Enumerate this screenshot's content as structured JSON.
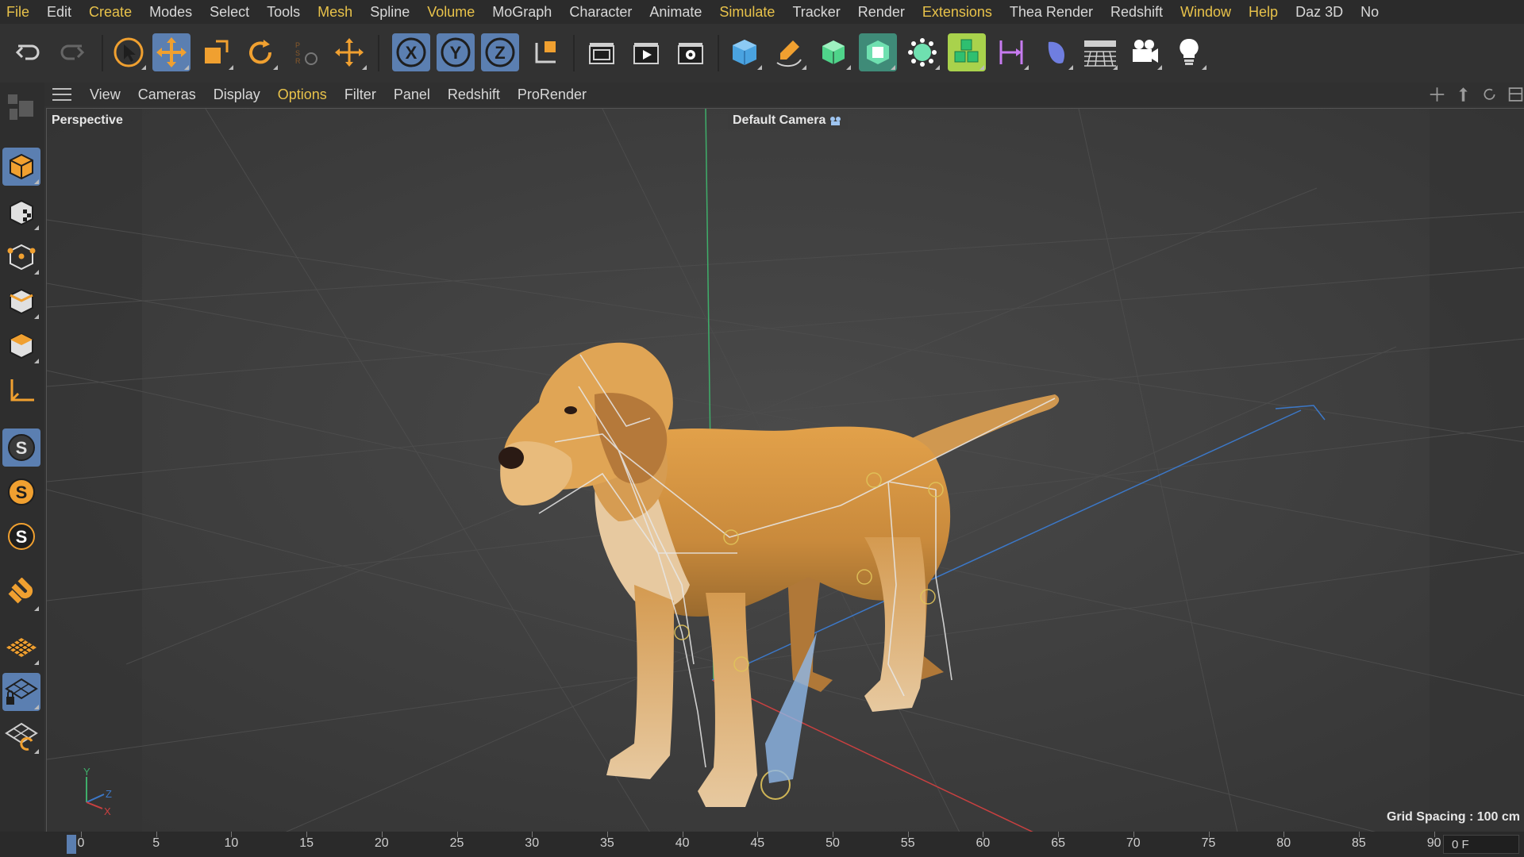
{
  "menu": {
    "items": [
      {
        "label": "File",
        "highlight": true
      },
      {
        "label": "Edit",
        "highlight": false
      },
      {
        "label": "Create",
        "highlight": true
      },
      {
        "label": "Modes",
        "highlight": false
      },
      {
        "label": "Select",
        "highlight": false
      },
      {
        "label": "Tools",
        "highlight": false
      },
      {
        "label": "Mesh",
        "highlight": true
      },
      {
        "label": "Spline",
        "highlight": false
      },
      {
        "label": "Volume",
        "highlight": true
      },
      {
        "label": "MoGraph",
        "highlight": false
      },
      {
        "label": "Character",
        "highlight": false
      },
      {
        "label": "Animate",
        "highlight": false
      },
      {
        "label": "Simulate",
        "highlight": true
      },
      {
        "label": "Tracker",
        "highlight": false
      },
      {
        "label": "Render",
        "highlight": false
      },
      {
        "label": "Extensions",
        "highlight": true
      },
      {
        "label": "Thea Render",
        "highlight": false
      },
      {
        "label": "Redshift",
        "highlight": false
      },
      {
        "label": "Window",
        "highlight": true
      },
      {
        "label": "Help",
        "highlight": true
      },
      {
        "label": "Daz 3D",
        "highlight": false
      },
      {
        "label": "No",
        "highlight": false
      }
    ]
  },
  "toolbar": {
    "icons": [
      "undo-icon",
      "redo-icon",
      "select-pointer-icon",
      "move-icon",
      "scale-icon",
      "rotate-icon",
      "psr-icon",
      "coordinate-move-icon",
      "x-axis-lock-icon",
      "y-axis-lock-icon",
      "z-axis-lock-icon",
      "world-coordinates-icon",
      "render-view-icon",
      "render-picture-viewer-icon",
      "render-settings-icon",
      "cube-primitive-icon",
      "pen-spline-icon",
      "subdivision-icon",
      "extrude-icon",
      "mograph-cloner-icon",
      "voxel-icon",
      "deformer-icon",
      "field-icon",
      "floor-icon",
      "camera-icon",
      "light-icon"
    ]
  },
  "viewport_menu": {
    "items": [
      {
        "label": "View",
        "highlight": false
      },
      {
        "label": "Cameras",
        "highlight": false
      },
      {
        "label": "Display",
        "highlight": false
      },
      {
        "label": "Options",
        "highlight": true
      },
      {
        "label": "Filter",
        "highlight": false
      },
      {
        "label": "Panel",
        "highlight": false
      },
      {
        "label": "Redshift",
        "highlight": false
      },
      {
        "label": "ProRender",
        "highlight": false
      }
    ]
  },
  "viewport": {
    "view_name": "Perspective",
    "camera_name": "Default Camera",
    "grid_spacing": "Grid Spacing : 100 cm",
    "axis_labels": {
      "y": "Y",
      "z": "Z",
      "x": "X"
    }
  },
  "left_toolbar": {
    "icons": [
      "make-editable-icon",
      "model-mode-icon",
      "texture-mode-icon",
      "points-mode-icon",
      "edges-mode-icon",
      "polygons-mode-icon",
      "axis-mode-icon",
      "solo-off-icon",
      "solo-single-icon",
      "solo-hierarchy-icon",
      "snap-magnet-icon",
      "workplane-icon",
      "locked-workplane-icon",
      "workplane-rotate-icon"
    ]
  },
  "timeline": {
    "ticks": [
      "0",
      "5",
      "10",
      "15",
      "20",
      "25",
      "30",
      "35",
      "40",
      "45",
      "50",
      "55",
      "60",
      "65",
      "70",
      "75",
      "80",
      "85",
      "90"
    ],
    "current_frame": "0 F"
  },
  "colors": {
    "accent_orange": "#f0a030",
    "active_blue": "#5b7fb1",
    "menu_highlight": "#e8c24a",
    "axis_x": "#c94040",
    "axis_y": "#3fae6a",
    "axis_z": "#3c78c8"
  }
}
